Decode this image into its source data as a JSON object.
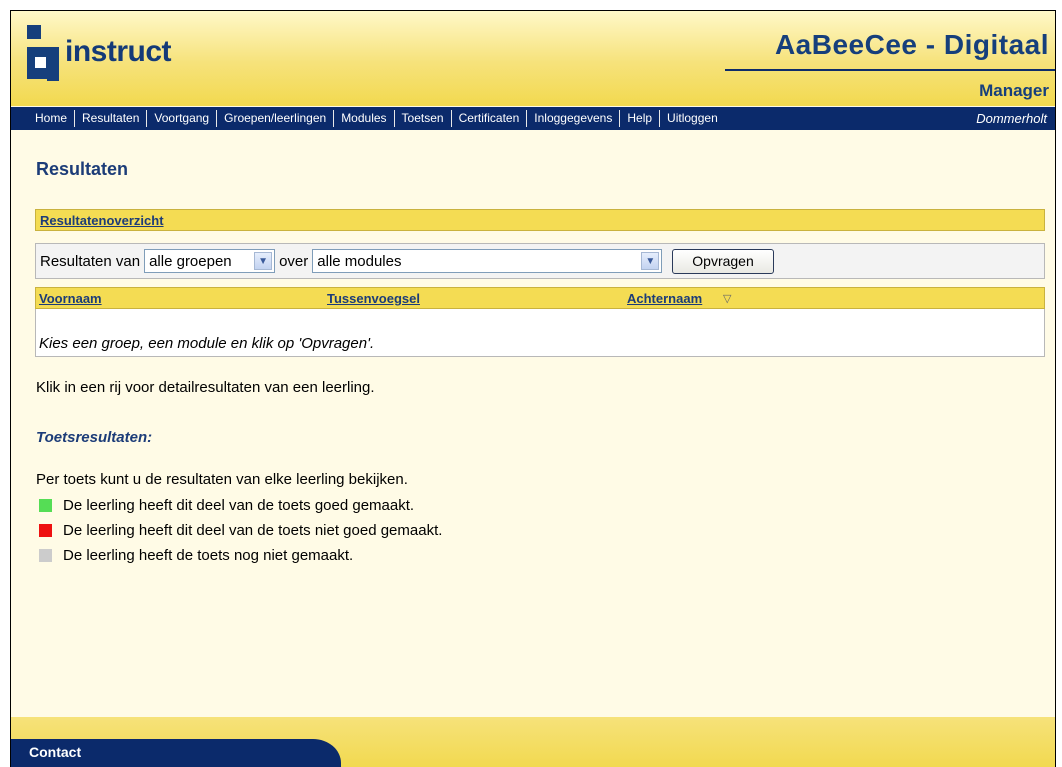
{
  "header": {
    "logo_text": "instruct",
    "brand": "AaBeeCee - Digitaal",
    "role": "Manager",
    "colors": {
      "yellow": "#f2d94f",
      "navy": "#0b2a6b",
      "title_blue": "#1c3c78"
    }
  },
  "nav": {
    "items": [
      "Home",
      "Resultaten",
      "Voortgang",
      "Groepen/leerlingen",
      "Modules",
      "Toetsen",
      "Certificaten",
      "Inloggegevens",
      "Help",
      "Uitloggen"
    ],
    "user": "Dommerholt"
  },
  "main": {
    "title": "Resultaten",
    "overview_link": "Resultatenoverzicht",
    "filter": {
      "label_from": "Resultaten van",
      "group_value": "alle groepen",
      "label_over": "over",
      "module_value": "alle modules",
      "button": "Opvragen",
      "caret_icon": "chevron-down-icon"
    },
    "table": {
      "columns": [
        "Voornaam",
        "Tussenvoegsel",
        "Achternaam"
      ],
      "sort_indicator": "▽",
      "empty_message": "Kies een groep, een module en klik op 'Opvragen'."
    },
    "hint": "Klik in een rij voor detailresultaten van een leerling.",
    "subheading": "Toetsresultaten:",
    "legend": {
      "intro": "Per toets kunt u de resultaten van elke leerling bekijken.",
      "items": [
        {
          "color": "#55dd55",
          "text": "De leerling heeft dit deel van de toets goed gemaakt."
        },
        {
          "color": "#ee1111",
          "text": "De leerling heeft dit deel van de toets niet goed gemaakt."
        },
        {
          "color": "#cccccc",
          "text": "De leerling heeft de toets nog niet gemaakt."
        }
      ]
    }
  },
  "footer": {
    "contact": "Contact"
  }
}
